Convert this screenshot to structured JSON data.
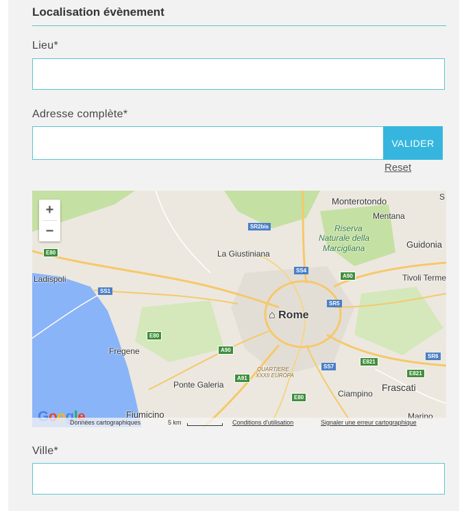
{
  "section": {
    "title": "Localisation évènement"
  },
  "fields": {
    "lieu": {
      "label": "Lieu*",
      "value": "",
      "placeholder": ""
    },
    "adresse": {
      "label": "Adresse complète*",
      "value": "",
      "placeholder": ""
    },
    "ville": {
      "label": "Ville*",
      "value": "",
      "placeholder": ""
    }
  },
  "buttons": {
    "valider": "VALIDER",
    "reset": "Reset"
  },
  "map": {
    "zoom_in": "+",
    "zoom_out": "−",
    "logo": [
      "G",
      "o",
      "o",
      "g",
      "l",
      "e"
    ],
    "places": {
      "monterotondo": "Monterotondo",
      "mentana": "Mentana",
      "riserva": "Riserva",
      "naturale": "Naturale della",
      "marcigliana": "Marcigliana",
      "guidonia": "Guidonia",
      "giustiniana": "La Giustiniana",
      "ladispoli": "Ladispoli",
      "tivoli": "Tivoli Terme",
      "rome": "Rome",
      "fregene": "Fregene",
      "quartiere": "QUARTIERE",
      "xxxii": "XXXII EUROPA",
      "ponte": "Ponte Galeria",
      "ciampino": "Ciampino",
      "frascati": "Frascati",
      "fiumicino": "Fiumicino",
      "marino": "Marino",
      "s_edge": "S"
    },
    "roads": {
      "sr2bis": "SR2bis",
      "ss4": "SS4",
      "a90_ne": "A90",
      "e80_w": "E80",
      "ss1": "SS1",
      "sr5": "SR5",
      "e80_mid": "E80",
      "a90_sw": "A90",
      "ss7": "SS7",
      "e821_a": "E821",
      "sr6": "SR6",
      "e821_b": "E821",
      "a91": "A91",
      "e80_s": "E80"
    },
    "footer": {
      "data": "Données cartographiques",
      "scale": "5 km",
      "terms": "Conditions d'utilisation",
      "report": "Signaler une erreur cartographique"
    },
    "colors": {
      "water": "#8ab4f8",
      "park": "#c5e0a3",
      "urban": "#e4e1da",
      "highway": "#f6c86a"
    }
  }
}
